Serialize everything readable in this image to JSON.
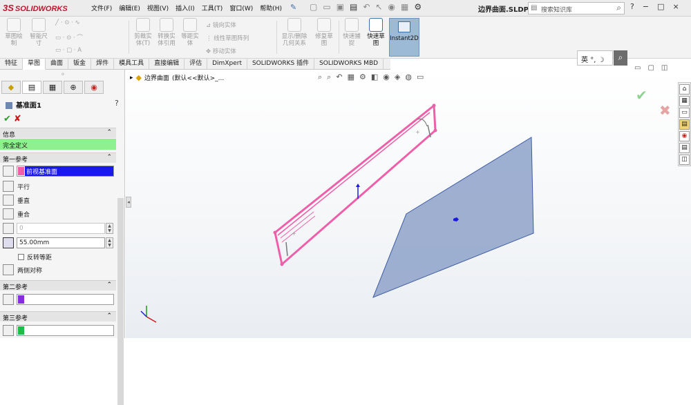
{
  "app": {
    "logo_text": "SOLIDWORKS",
    "logo_mark": "3S",
    "doc_title": "边界曲面.SLDPR..."
  },
  "menu": [
    "文件(F)",
    "编辑(E)",
    "视图(V)",
    "插入(I)",
    "工具(T)",
    "窗口(W)",
    "帮助(H)"
  ],
  "search": {
    "placeholder": "搜索知识库"
  },
  "window_controls": [
    "?",
    "−",
    "□",
    "×"
  ],
  "ribbon": {
    "sketch_draw": "草图绘\n制",
    "smart_dim": "智能尺\n寸",
    "trim": "剪裁实\n体(T)",
    "convert": "转换实\n体引用",
    "offset": "等距实\n体",
    "mirror": "镜向实体",
    "linear_pattern": "线性草图阵列",
    "move": "移动实体",
    "show_relations": "显示/删除\n几何关系",
    "repair": "修复草\n图",
    "quick_snap": "快速捕\n捉",
    "rapid_sketch": "快速草\n图",
    "instant2d": "Instant2D"
  },
  "tabs": [
    "特征",
    "草图",
    "曲面",
    "钣金",
    "焊件",
    "模具工具",
    "直接编辑",
    "评估",
    "DimXpert",
    "SOLIDWORKS 插件",
    "SOLIDWORKS MBD"
  ],
  "ime": {
    "label": "英",
    "glyphs": "°,"
  },
  "panel": {
    "title": "基准面1",
    "help": "?",
    "info_header": "信息",
    "status": "完全定义",
    "first_ref_header": "第一参考",
    "first_ref_value": "前视基准面",
    "parallel": "平行",
    "perpendicular": "垂直",
    "coincident": "重合",
    "angle_value": "0",
    "distance_value": "55.00mm",
    "flip_offset": "反转等距",
    "mid_plane": "两侧对称",
    "second_ref_header": "第二参考",
    "third_ref_header": "第三参考"
  },
  "canvas": {
    "breadcrumb": "边界曲面",
    "breadcrumb_config": "(默认<<默认>_..."
  },
  "colors": {
    "sketch": "#ee5faa",
    "plane": "#8ea2c9",
    "plane_edge": "#3b5aa3",
    "status_ok": "#8ef08e"
  }
}
